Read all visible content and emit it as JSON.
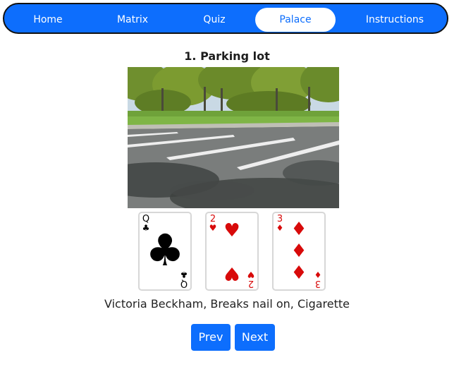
{
  "nav": {
    "items": [
      {
        "label": "Home",
        "active": false
      },
      {
        "label": "Matrix",
        "active": false
      },
      {
        "label": "Quiz",
        "active": false
      },
      {
        "label": "Palace",
        "active": true
      },
      {
        "label": "Instructions",
        "active": false
      }
    ]
  },
  "location": {
    "title": "1. Parking lot",
    "image_icon": "parking-lot-photo"
  },
  "cards": [
    {
      "rank": "Q",
      "suit": "♣",
      "color": "black"
    },
    {
      "rank": "2",
      "suit": "♥",
      "color": "red"
    },
    {
      "rank": "3",
      "suit": "♦",
      "color": "red"
    }
  ],
  "caption": "Victoria Beckham, Breaks nail on, Cigarette",
  "buttons": {
    "prev_label": "Prev",
    "next_label": "Next"
  },
  "colors": {
    "accent": "#0d6efd",
    "card_red": "#d80a0a"
  }
}
